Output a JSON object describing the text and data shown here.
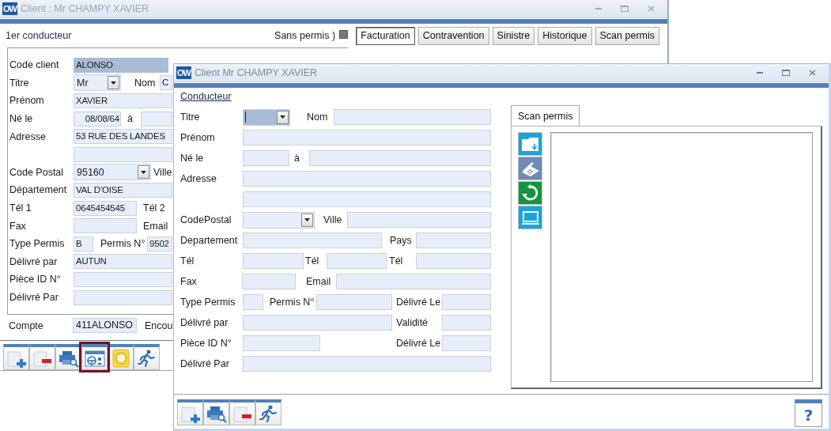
{
  "back_window": {
    "app_icon": "OW",
    "title": "Client : Mr CHAMPY XAVIER",
    "section": "1er conducteur",
    "sans_permis": {
      "label": "Sans permis )",
      "checked": true
    },
    "tabs": [
      {
        "label": "Facturation",
        "selected": true
      },
      {
        "label": "Contravention",
        "selected": false
      },
      {
        "label": "Sinistre",
        "selected": false
      },
      {
        "label": "Historique",
        "selected": false
      },
      {
        "label": "Scan permis",
        "selected": false
      }
    ],
    "form": [
      [
        {
          "kind": "label",
          "text": "Code client"
        },
        {
          "kind": "field",
          "value": "ALONSO",
          "focused": true
        }
      ],
      [
        {
          "kind": "label",
          "text": "Titre"
        },
        {
          "kind": "combo",
          "value": "Mr",
          "focused": false
        },
        {
          "kind": "label",
          "text": "Nom"
        },
        {
          "kind": "field",
          "value": "C",
          "focused": false
        }
      ],
      [
        {
          "kind": "label",
          "text": "Prénom"
        },
        {
          "kind": "field",
          "value": "XAVIER",
          "focused": false
        }
      ],
      [
        {
          "kind": "label",
          "text": "Né le"
        },
        {
          "kind": "field",
          "value": "08/08/64",
          "focused": false
        },
        {
          "kind": "label",
          "text": "à"
        },
        {
          "kind": "field",
          "focused": false
        }
      ],
      [
        {
          "kind": "label",
          "text": "Adresse"
        },
        {
          "kind": "field",
          "value": "53 RUE DES LANDES",
          "focused": false
        }
      ],
      [
        {
          "kind": "field",
          "focused": false
        }
      ],
      [
        {
          "kind": "label",
          "text": "Code Postal"
        },
        {
          "kind": "combo",
          "value": "95160",
          "focused": false
        },
        {
          "kind": "label",
          "text": "Ville"
        }
      ],
      [
        {
          "kind": "label",
          "text": "Département"
        },
        {
          "kind": "field",
          "value": "VAL D'OISE",
          "focused": false
        }
      ],
      [
        {
          "kind": "label",
          "text": "Tél 1"
        },
        {
          "kind": "field",
          "value": "0645454545",
          "focused": false
        },
        {
          "kind": "label",
          "text": "Tél 2"
        }
      ],
      [
        {
          "kind": "label",
          "text": "Fax"
        },
        {
          "kind": "field",
          "focused": false
        },
        {
          "kind": "label",
          "text": "Email"
        }
      ],
      [
        {
          "kind": "label",
          "text": "Type Permis"
        },
        {
          "kind": "field",
          "value": "B",
          "focused": false
        },
        {
          "kind": "label",
          "text": "Permis N°"
        },
        {
          "kind": "field",
          "value": "9502",
          "focused": false
        }
      ],
      [
        {
          "kind": "label",
          "text": "Délivré par"
        },
        {
          "kind": "field",
          "value": "AUTUN",
          "focused": false
        }
      ],
      [
        {
          "kind": "label",
          "text": "Pièce ID N°"
        },
        {
          "kind": "field",
          "focused": false
        }
      ],
      [
        {
          "kind": "label",
          "text": "Délivré Par"
        },
        {
          "kind": "field",
          "focused": false
        }
      ]
    ],
    "account": [
      {
        "kind": "label",
        "text": "Compte"
      },
      {
        "kind": "field",
        "value": "411ALONSO",
        "focused": false
      },
      {
        "kind": "label",
        "text": "Encou"
      }
    ],
    "toolbar": [
      {
        "kind": "new",
        "selected": false
      },
      {
        "kind": "delete",
        "selected": false
      },
      {
        "kind": "print-preview",
        "selected": false
      },
      {
        "kind": "driver-card",
        "selected": true
      },
      {
        "kind": "ring",
        "selected": false
      },
      {
        "kind": "exit",
        "selected": false
      }
    ]
  },
  "front_window": {
    "app_icon": "OW",
    "title": "Client Mr CHAMPY XAVIER",
    "section_link": "Conducteur",
    "form": [
      [
        {
          "kind": "label",
          "text": "Titre"
        },
        {
          "kind": "combo",
          "focused": true
        },
        {
          "kind": "label",
          "text": "Nom"
        },
        {
          "kind": "field",
          "focused": false
        }
      ],
      [
        {
          "kind": "label",
          "text": "Prénom"
        },
        {
          "kind": "field",
          "focused": false
        }
      ],
      [
        {
          "kind": "label",
          "text": "Né le"
        },
        {
          "kind": "field",
          "focused": false
        },
        {
          "kind": "label",
          "text": "à"
        },
        {
          "kind": "field",
          "focused": false
        }
      ],
      [
        {
          "kind": "label",
          "text": "Adresse"
        },
        {
          "kind": "field",
          "focused": false
        }
      ],
      [
        {
          "kind": "field",
          "focused": false
        }
      ],
      [
        {
          "kind": "label",
          "text": "CodePostal"
        },
        {
          "kind": "combo",
          "focused": false
        },
        {
          "kind": "label",
          "text": "Ville"
        },
        {
          "kind": "field",
          "focused": false
        }
      ],
      [
        {
          "kind": "label",
          "text": "Departement"
        },
        {
          "kind": "field",
          "focused": false
        },
        {
          "kind": "label",
          "text": "Pays"
        },
        {
          "kind": "field",
          "focused": false
        }
      ],
      [
        {
          "kind": "label",
          "text": "Tél"
        },
        {
          "kind": "field",
          "focused": false
        },
        {
          "kind": "label",
          "text": "Tél"
        },
        {
          "kind": "field",
          "focused": false
        },
        {
          "kind": "label",
          "text": "Tél"
        },
        {
          "kind": "field",
          "focused": false
        }
      ],
      [
        {
          "kind": "label",
          "text": "Fax"
        },
        {
          "kind": "field",
          "focused": false
        },
        {
          "kind": "label",
          "text": "Email"
        },
        {
          "kind": "field",
          "focused": false
        }
      ],
      [
        {
          "kind": "label",
          "text": "Type Permis"
        },
        {
          "kind": "field",
          "focused": false
        },
        {
          "kind": "label",
          "text": "Permis N°"
        },
        {
          "kind": "field",
          "focused": false
        },
        {
          "kind": "label",
          "text": "Délivré Le"
        },
        {
          "kind": "field",
          "focused": false
        }
      ],
      [
        {
          "kind": "label",
          "text": "Délivré par"
        },
        {
          "kind": "field",
          "focused": false
        },
        {
          "kind": "label",
          "text": "Validité"
        },
        {
          "kind": "field",
          "focused": false
        }
      ],
      [
        {
          "kind": "label",
          "text": "Pièce ID N°"
        },
        {
          "kind": "field",
          "focused": false
        },
        {
          "kind": "label",
          "text": "Délivré Le"
        },
        {
          "kind": "field",
          "focused": false
        }
      ],
      [
        {
          "kind": "label",
          "text": "Délivré Par"
        },
        {
          "kind": "field",
          "focused": false
        }
      ]
    ],
    "scan_tab": {
      "label": "Scan permis",
      "selected": true
    },
    "scan_tools": [
      {
        "kind": "folder"
      },
      {
        "kind": "scanner"
      },
      {
        "kind": "refresh"
      },
      {
        "kind": "screen"
      }
    ],
    "toolbar": [
      {
        "kind": "new",
        "selected": false
      },
      {
        "kind": "print-preview",
        "selected": false
      },
      {
        "kind": "delete",
        "selected": false
      },
      {
        "kind": "exit",
        "selected": false
      }
    ],
    "help": "?"
  }
}
